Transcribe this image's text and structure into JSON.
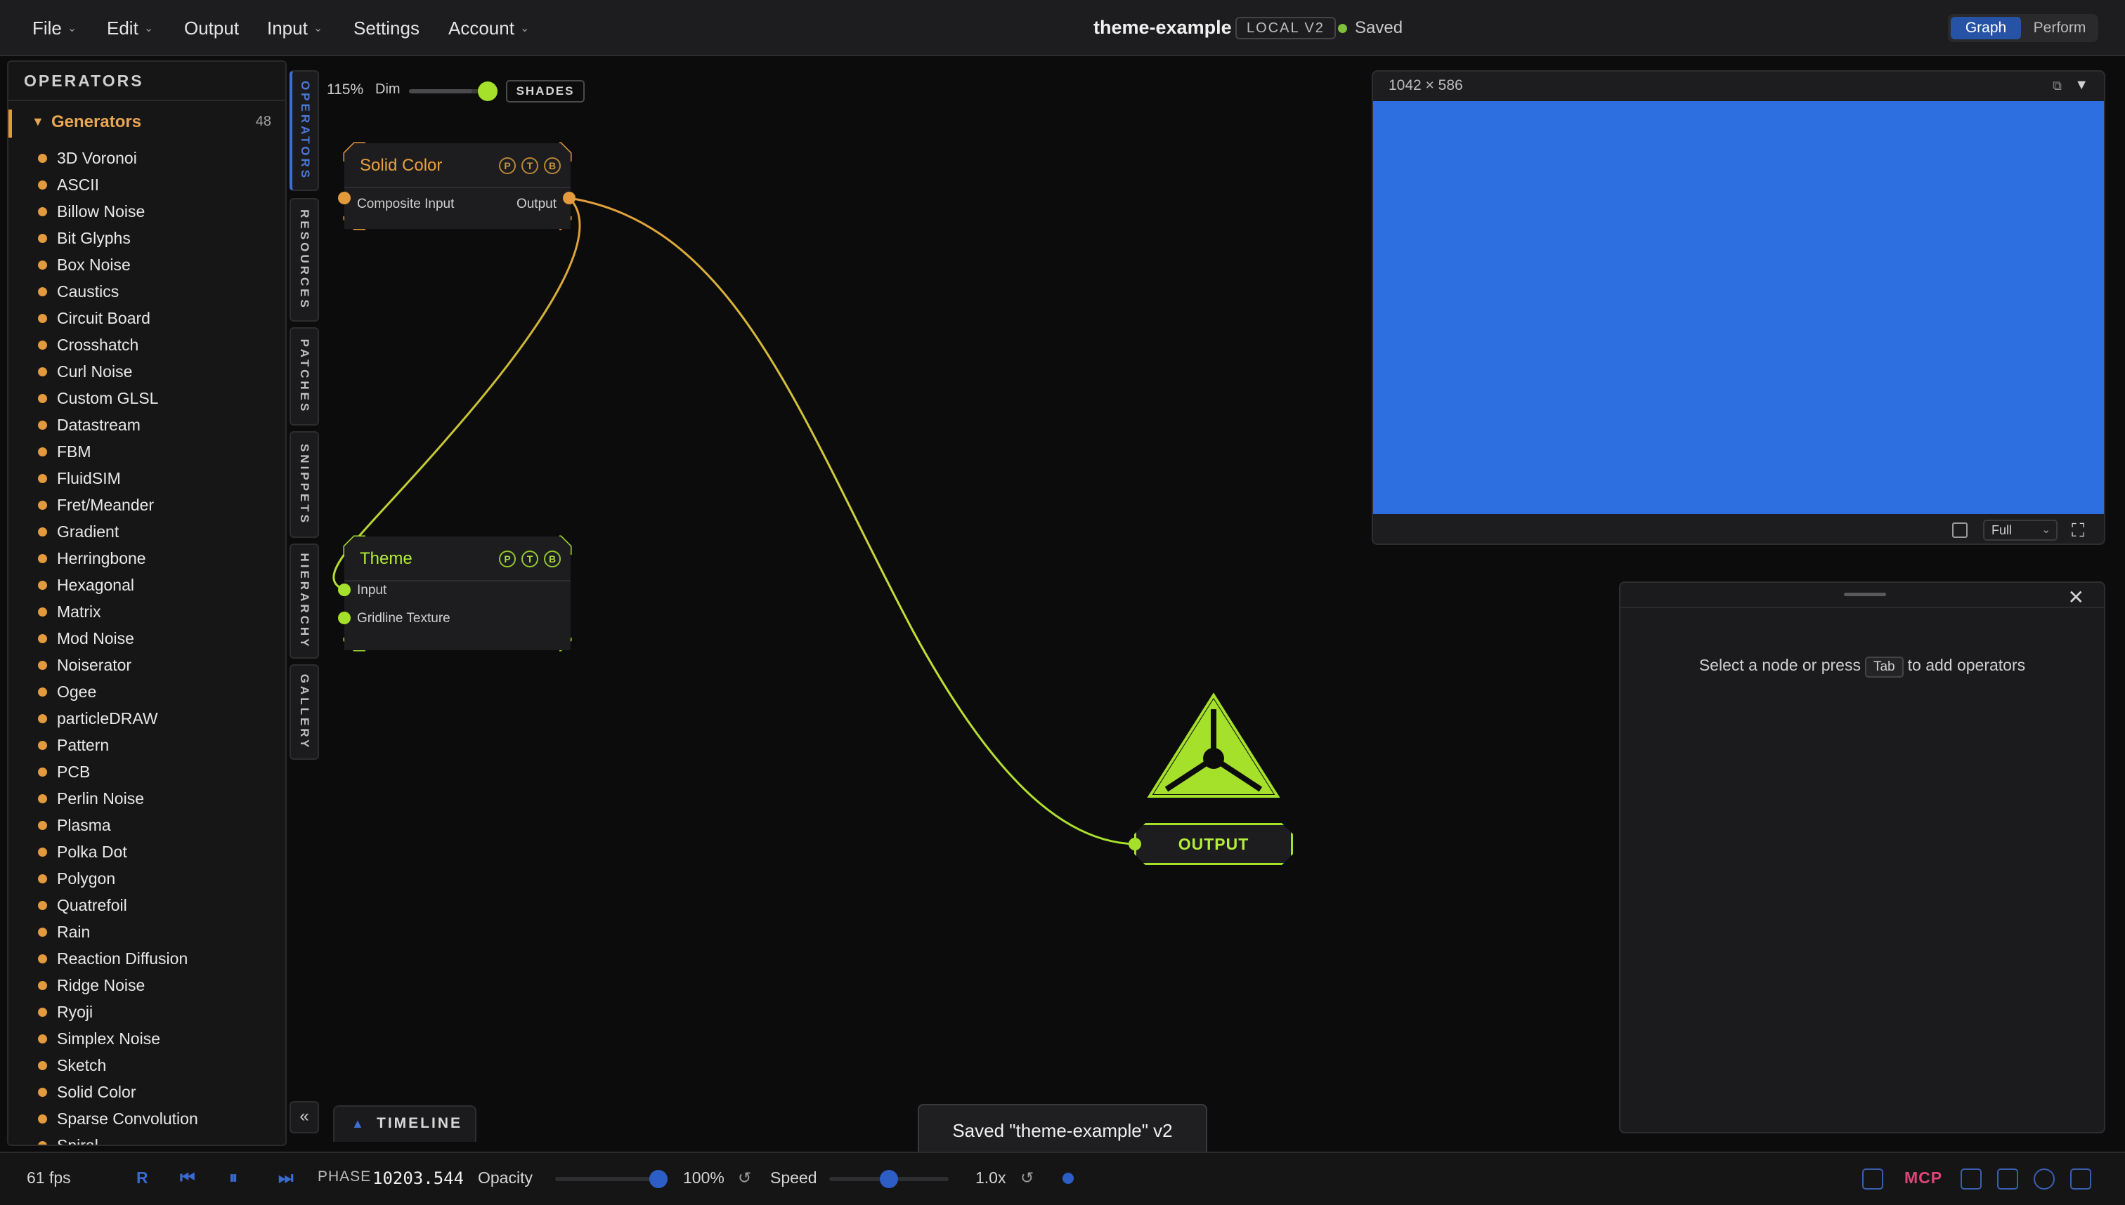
{
  "menubar": {
    "items": [
      {
        "label": "File",
        "chevron": true
      },
      {
        "label": "Edit",
        "chevron": true
      },
      {
        "label": "Output",
        "chevron": false
      },
      {
        "label": "Input",
        "chevron": true
      },
      {
        "label": "Settings",
        "chevron": false
      },
      {
        "label": "Account",
        "chevron": true
      }
    ],
    "project_title": "theme-example",
    "project_badge": "LOCAL V2",
    "save_status": "Saved",
    "modes": [
      "Graph",
      "Perform"
    ],
    "active_mode": "Graph"
  },
  "sidebar": {
    "title": "OPERATORS",
    "category": {
      "label": "Generators",
      "count": "48",
      "expanded": true
    },
    "items": [
      "3D Voronoi",
      "ASCII",
      "Billow Noise",
      "Bit Glyphs",
      "Box Noise",
      "Caustics",
      "Circuit Board",
      "Crosshatch",
      "Curl Noise",
      "Custom GLSL",
      "Datastream",
      "FBM",
      "FluidSIM",
      "Fret/Meander",
      "Gradient",
      "Herringbone",
      "Hexagonal",
      "Matrix",
      "Mod Noise",
      "Noiserator",
      "Ogee",
      "particleDRAW",
      "Pattern",
      "PCB",
      "Perlin Noise",
      "Plasma",
      "Polka Dot",
      "Polygon",
      "Quatrefoil",
      "Rain",
      "Reaction Diffusion",
      "Ridge Noise",
      "Ryoji",
      "Simplex Noise",
      "Sketch",
      "Solid Color",
      "Sparse Convolution",
      "Spiral"
    ]
  },
  "vertical_tabs": [
    {
      "label": "OPERATORS",
      "active": true
    },
    {
      "label": "RESOURCES",
      "active": false
    },
    {
      "label": "PATCHES",
      "active": false
    },
    {
      "label": "SNIPPETS",
      "active": false
    },
    {
      "label": "HIERARCHY",
      "active": false
    },
    {
      "label": "GALLERY",
      "active": false
    }
  ],
  "collapse_glyph": "«",
  "canvas": {
    "zoom": "115%",
    "dim_label": "Dim",
    "dim_level": 0.8,
    "shades_label": "SHADES"
  },
  "nodes": {
    "solid_color": {
      "title": "Solid Color",
      "buttons": [
        "P",
        "T",
        "B"
      ],
      "input": "Composite Input",
      "output": "Output",
      "accent": "#e29a3c"
    },
    "theme": {
      "title": "Theme",
      "buttons": [
        "P",
        "T",
        "B"
      ],
      "inputs": [
        "Input",
        "Gridline Texture"
      ],
      "accent": "#a5e02a"
    },
    "output": {
      "label": "OUTPUT",
      "accent": "#a5e02a"
    }
  },
  "preview": {
    "dims": "1042 × 586",
    "menu_glyph": "▼",
    "fill_color": "#2d6ee0",
    "quality": "Full"
  },
  "inspector": {
    "msg_before": "Select a node or press",
    "key": "Tab",
    "msg_after": "to add operators",
    "close_glyph": "✕"
  },
  "timeline": {
    "label": "TIMELINE"
  },
  "toast": {
    "message": "Saved \"theme-example\" v2"
  },
  "bottombar": {
    "fps": "61 fps",
    "record": "R",
    "phase_label": "PHASE",
    "phase_value": "10203.544",
    "opacity_label": "Opacity",
    "opacity_value": "100%",
    "opacity_level": 1.0,
    "speed_label": "Speed",
    "speed_value": "1.0x",
    "speed_level": 0.5,
    "mcp": "MCP"
  }
}
